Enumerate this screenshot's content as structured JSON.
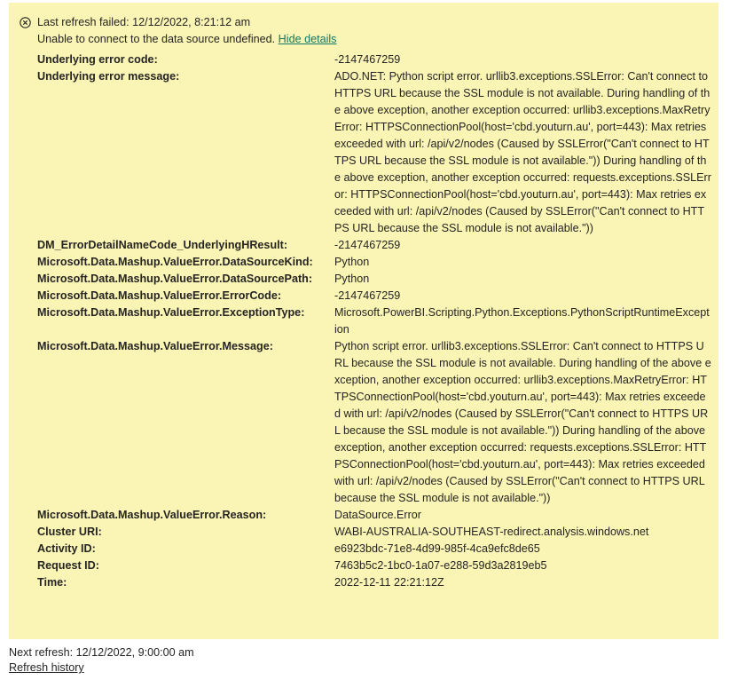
{
  "banner": {
    "status_icon": "error-circle-icon",
    "title": "Last refresh failed: 12/12/2022, 8:21:12 am",
    "message": "Unable to connect to the data source undefined.",
    "hide_details_label": "Hide details"
  },
  "details": [
    {
      "key": "Underlying error code:",
      "value": "-2147467259"
    },
    {
      "key": "Underlying error message:",
      "value": "ADO.NET: Python script error. urllib3.exceptions.SSLError: Can't connect to HTTPS URL because the SSL module is not available. During handling of the above exception, another exception occurred: urllib3.exceptions.MaxRetryError: HTTPSConnectionPool(host='cbd.youturn.au', port=443): Max retries exceeded with url: /api/v2/nodes (Caused by SSLError(\"Can't connect to HTTPS URL because the SSL module is not available.\")) During handling of the above exception, another exception occurred: requests.exceptions.SSLError: HTTPSConnectionPool(host='cbd.youturn.au', port=443): Max retries exceeded with url: /api/v2/nodes (Caused by SSLError(\"Can't connect to HTTPS URL because the SSL module is not available.\"))"
    },
    {
      "key": "DM_ErrorDetailNameCode_UnderlyingHResult:",
      "value": "-2147467259"
    },
    {
      "key": "Microsoft.Data.Mashup.ValueError.DataSourceKind:",
      "value": "Python"
    },
    {
      "key": "Microsoft.Data.Mashup.ValueError.DataSourcePath:",
      "value": "Python"
    },
    {
      "key": "Microsoft.Data.Mashup.ValueError.ErrorCode:",
      "value": "-2147467259"
    },
    {
      "key": "Microsoft.Data.Mashup.ValueError.ExceptionType:",
      "value": "Microsoft.PowerBI.Scripting.Python.Exceptions.PythonScriptRuntimeException"
    },
    {
      "key": "Microsoft.Data.Mashup.ValueError.Message:",
      "value": "Python script error. urllib3.exceptions.SSLError: Can't connect to HTTPS URL because the SSL module is not available. During handling of the above exception, another exception occurred: urllib3.exceptions.MaxRetryError: HTTPSConnectionPool(host='cbd.youturn.au', port=443): Max retries exceeded with url: /api/v2/nodes (Caused by SSLError(\"Can't connect to HTTPS URL because the SSL module is not available.\")) During handling of the above exception, another exception occurred: requests.exceptions.SSLError: HTTPSConnectionPool(host='cbd.youturn.au', port=443): Max retries exceeded with url: /api/v2/nodes (Caused by SSLError(\"Can't connect to HTTPS URL because the SSL module is not available.\"))"
    },
    {
      "key": "Microsoft.Data.Mashup.ValueError.Reason:",
      "value": "DataSource.Error"
    },
    {
      "key": "Cluster URI:",
      "value": "WABI-AUSTRALIA-SOUTHEAST-redirect.analysis.windows.net"
    },
    {
      "key": "Activity ID:",
      "value": "e6923bdc-71e8-4d99-985f-4ca9efc8de65"
    },
    {
      "key": "Request ID:",
      "value": "7463b5c2-1bc0-1a07-e288-59d3a2819eb5"
    },
    {
      "key": "Time:",
      "value": "2022-12-11 22:21:12Z"
    }
  ],
  "footer": {
    "next_refresh": "Next refresh: 12/12/2022, 9:00:00 am",
    "refresh_history_label": "Refresh history"
  },
  "colors": {
    "panel_background": "#faf5b4",
    "link": "#117865",
    "text": "#252423"
  }
}
